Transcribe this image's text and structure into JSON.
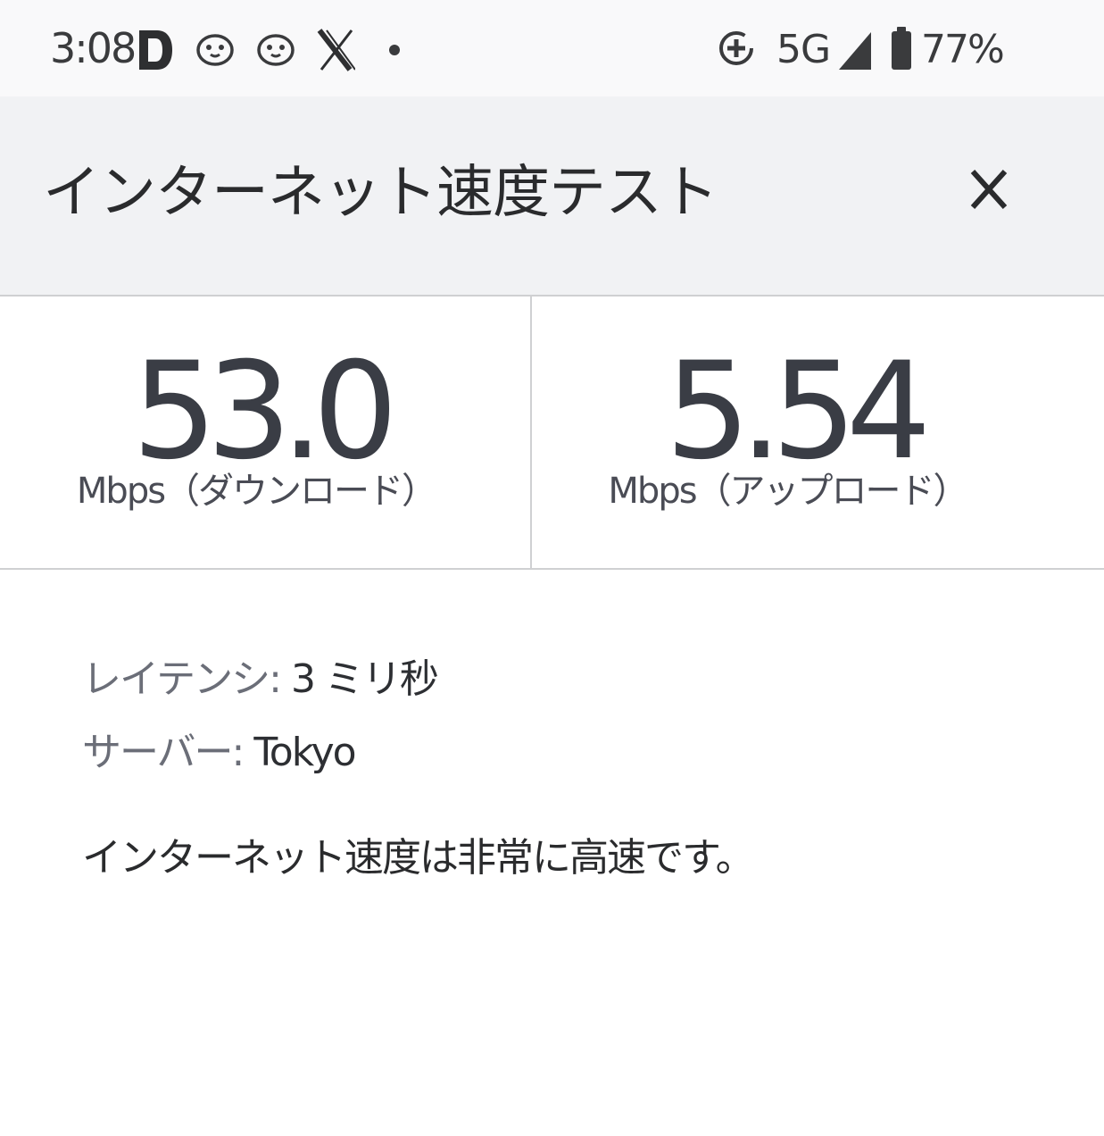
{
  "status_bar": {
    "time": "3:08",
    "notification_icons": [
      "d-app-icon",
      "penguin-icon",
      "penguin-icon",
      "x-app-icon",
      "more-dot-icon"
    ],
    "network": "5G",
    "battery_percent": "77%",
    "battery_level": 0.77,
    "system_icons": [
      "data-saver-icon",
      "signal-icon",
      "battery-icon"
    ]
  },
  "header": {
    "title": "インターネット速度テスト",
    "close_icon": "close-icon"
  },
  "results": {
    "download": {
      "value": "53.0",
      "unit_label": "Mbps（ダウンロード）"
    },
    "upload": {
      "value": "5.54",
      "unit_label": "Mbps（アップロード）"
    }
  },
  "details": {
    "latency_label": "レイテンシ:",
    "latency_value": " 3 ミリ秒",
    "server_label": "サーバー:",
    "server_value": " Tokyo"
  },
  "summary": "インターネット速度は非常に高速です。",
  "colors": {
    "header_bg": "#f1f2f4",
    "divider": "#cfd0d2",
    "value_text": "#3a3d45",
    "muted_text": "#6b6e78"
  }
}
